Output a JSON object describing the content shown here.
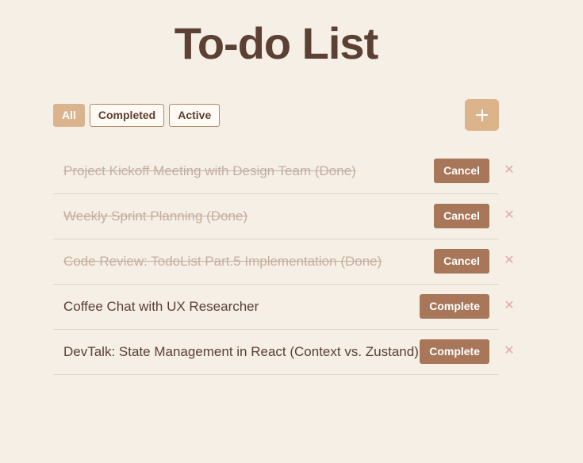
{
  "app": {
    "title": "To-do List"
  },
  "filters": {
    "all_label": "All",
    "completed_label": "Completed",
    "active_label": "Active",
    "selected": "All"
  },
  "toolbar": {
    "add_icon": "plus-icon"
  },
  "todos": [
    {
      "text": "Project Kickoff Meeting with Design Team (Done)",
      "done": true,
      "action_label": "Cancel"
    },
    {
      "text": "Weekly Sprint Planning (Done)",
      "done": true,
      "action_label": "Cancel"
    },
    {
      "text": "Code Review: TodoList Part.5 Implementation (Done)",
      "done": true,
      "action_label": "Cancel"
    },
    {
      "text": "Coffee Chat with UX Researcher",
      "done": false,
      "action_label": "Complete"
    },
    {
      "text": "DevTalk: State Management in React (Context vs. Zustand)",
      "done": false,
      "action_label": "Complete"
    }
  ],
  "delete_icon": "close-icon",
  "delete_glyph": "✕",
  "colors": {
    "background": "#f5efe6",
    "title": "#5c4033",
    "accent": "#d9b48f",
    "action": "#a87658",
    "done_text": "#c4ae9e",
    "delete": "#e3aaa5"
  }
}
